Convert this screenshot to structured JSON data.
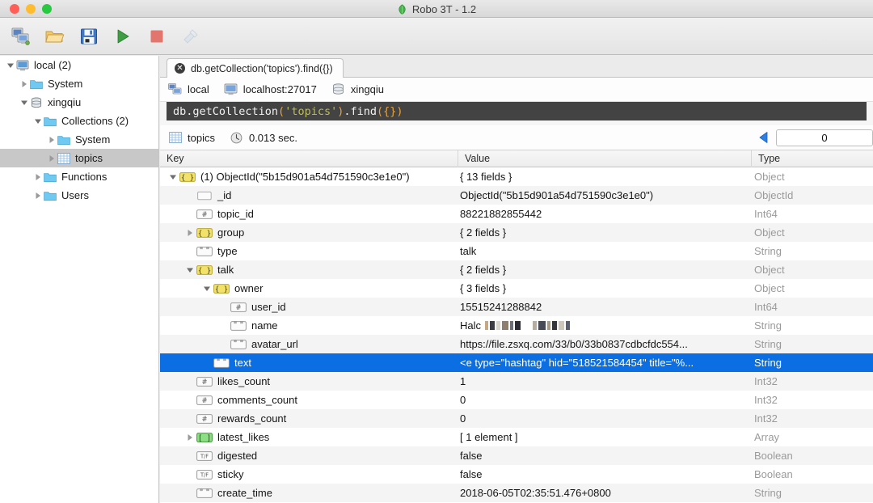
{
  "window": {
    "title": "Robo 3T - 1.2",
    "app_icon": "leaf-icon",
    "controls": [
      "close",
      "minimize",
      "zoom"
    ]
  },
  "toolbar": {
    "buttons": [
      {
        "name": "connect-button",
        "icon": "computer-connect-icon",
        "disabled": false
      },
      {
        "name": "open-script-button",
        "icon": "folder-open-icon",
        "disabled": false
      },
      {
        "name": "save-script-button",
        "icon": "floppy-save-icon",
        "disabled": false
      },
      {
        "name": "execute-button",
        "icon": "play-triangle-icon",
        "disabled": false
      },
      {
        "name": "stop-button",
        "icon": "stop-square-icon",
        "disabled": false
      },
      {
        "name": "tools-button",
        "icon": "wrench-tools-icon",
        "disabled": true
      }
    ]
  },
  "sidebar": {
    "items": [
      {
        "label": "local (2)",
        "icon": "server-icon",
        "indent": 0,
        "twisty": "down",
        "selected": false
      },
      {
        "label": "System",
        "icon": "folder-icon",
        "indent": 1,
        "twisty": "right",
        "selected": false
      },
      {
        "label": "xingqiu",
        "icon": "database-icon",
        "indent": 1,
        "twisty": "down",
        "selected": false
      },
      {
        "label": "Collections (2)",
        "icon": "folder-icon",
        "indent": 2,
        "twisty": "down",
        "selected": false
      },
      {
        "label": "System",
        "icon": "folder-icon",
        "indent": 3,
        "twisty": "right",
        "selected": false
      },
      {
        "label": "topics",
        "icon": "collection-icon",
        "indent": 3,
        "twisty": "right",
        "selected": true
      },
      {
        "label": "Functions",
        "icon": "folder-icon",
        "indent": 2,
        "twisty": "right",
        "selected": false
      },
      {
        "label": "Users",
        "icon": "folder-icon",
        "indent": 2,
        "twisty": "right",
        "selected": false
      }
    ]
  },
  "tabs": [
    {
      "label": "db.getCollection('topics').find({})",
      "active": true,
      "close_glyph": "✕"
    }
  ],
  "breadcrumb": [
    {
      "label": "local",
      "icon": "computer-connect-icon"
    },
    {
      "label": "localhost:27017",
      "icon": "server-icon"
    },
    {
      "label": "xingqiu",
      "icon": "database-icon"
    }
  ],
  "editor": {
    "tokens": [
      {
        "text": "db.getCollection",
        "cls": "c-plain"
      },
      {
        "text": "(",
        "cls": "c-paren"
      },
      {
        "text": "'topics'",
        "cls": "c-string"
      },
      {
        "text": ")",
        "cls": "c-paren"
      },
      {
        "text": ".find",
        "cls": "c-plain"
      },
      {
        "text": "({})",
        "cls": "c-paren"
      }
    ]
  },
  "result_bar": {
    "collection": "topics",
    "collection_icon": "collection-icon",
    "time": "0.013 sec.",
    "time_icon": "clock-icon",
    "prev_icon": "left-triangle-icon",
    "page_value": "0"
  },
  "table": {
    "columns": [
      "Key",
      "Value",
      "Type"
    ],
    "rows": [
      {
        "key": "(1) ObjectId(\"5b15d901a54d751590c3e1e0\")",
        "value": "{ 13 fields }",
        "type": "Object",
        "indent": 0,
        "twisty": "down",
        "icon": "object-braces-icon",
        "selected": false
      },
      {
        "key": "_id",
        "value": "ObjectId(\"5b15d901a54d751590c3e1e0\")",
        "type": "ObjectId",
        "indent": 1,
        "twisty": "none",
        "icon": "objectid-icon",
        "selected": false
      },
      {
        "key": "topic_id",
        "value": "88221882855442",
        "type": "Int64",
        "indent": 1,
        "twisty": "none",
        "icon": "number-hash-icon",
        "selected": false
      },
      {
        "key": "group",
        "value": "{ 2 fields }",
        "type": "Object",
        "indent": 1,
        "twisty": "right",
        "icon": "object-braces-icon",
        "selected": false
      },
      {
        "key": "type",
        "value": "talk",
        "type": "String",
        "indent": 1,
        "twisty": "none",
        "icon": "string-quotes-icon",
        "selected": false
      },
      {
        "key": "talk",
        "value": "{ 2 fields }",
        "type": "Object",
        "indent": 1,
        "twisty": "down",
        "icon": "object-braces-icon",
        "selected": false
      },
      {
        "key": "owner",
        "value": "{ 3 fields }",
        "type": "Object",
        "indent": 2,
        "twisty": "down",
        "icon": "object-braces-icon",
        "selected": false
      },
      {
        "key": "user_id",
        "value": "15515241288842",
        "type": "Int64",
        "indent": 3,
        "twisty": "none",
        "icon": "number-hash-icon",
        "selected": false
      },
      {
        "key": "name",
        "value": "Halc",
        "type": "String",
        "indent": 3,
        "twisty": "none",
        "icon": "string-quotes-icon",
        "selected": false,
        "redacted": true
      },
      {
        "key": "avatar_url",
        "value": "https://file.zsxq.com/33/b0/33b0837cdbcfdc554...",
        "type": "String",
        "indent": 3,
        "twisty": "none",
        "icon": "string-quotes-icon",
        "selected": false
      },
      {
        "key": "text",
        "value": "<e type=\"hashtag\" hid=\"518521584454\" title=\"%...",
        "type": "String",
        "indent": 2,
        "twisty": "none",
        "icon": "string-quotes-icon",
        "selected": true
      },
      {
        "key": "likes_count",
        "value": "1",
        "type": "Int32",
        "indent": 1,
        "twisty": "none",
        "icon": "number-hash-icon",
        "selected": false
      },
      {
        "key": "comments_count",
        "value": "0",
        "type": "Int32",
        "indent": 1,
        "twisty": "none",
        "icon": "number-hash-icon",
        "selected": false
      },
      {
        "key": "rewards_count",
        "value": "0",
        "type": "Int32",
        "indent": 1,
        "twisty": "none",
        "icon": "number-hash-icon",
        "selected": false
      },
      {
        "key": "latest_likes",
        "value": "[ 1 element ]",
        "type": "Array",
        "indent": 1,
        "twisty": "right",
        "icon": "array-brackets-icon",
        "selected": false
      },
      {
        "key": "digested",
        "value": "false",
        "type": "Boolean",
        "indent": 1,
        "twisty": "none",
        "icon": "boolean-tf-icon",
        "selected": false
      },
      {
        "key": "sticky",
        "value": "false",
        "type": "Boolean",
        "indent": 1,
        "twisty": "none",
        "icon": "boolean-tf-icon",
        "selected": false
      },
      {
        "key": "create_time",
        "value": "2018-06-05T02:35:51.476+0800",
        "type": "String",
        "indent": 1,
        "twisty": "none",
        "icon": "string-quotes-icon",
        "selected": false
      }
    ]
  },
  "colors": {
    "selection_blue": "#0b6fe3",
    "sidebar_selection": "#c8c8c8",
    "editor_bg": "#434343",
    "folder_blue": "#6fc9f0",
    "type_gray": "#9a9a9a"
  }
}
